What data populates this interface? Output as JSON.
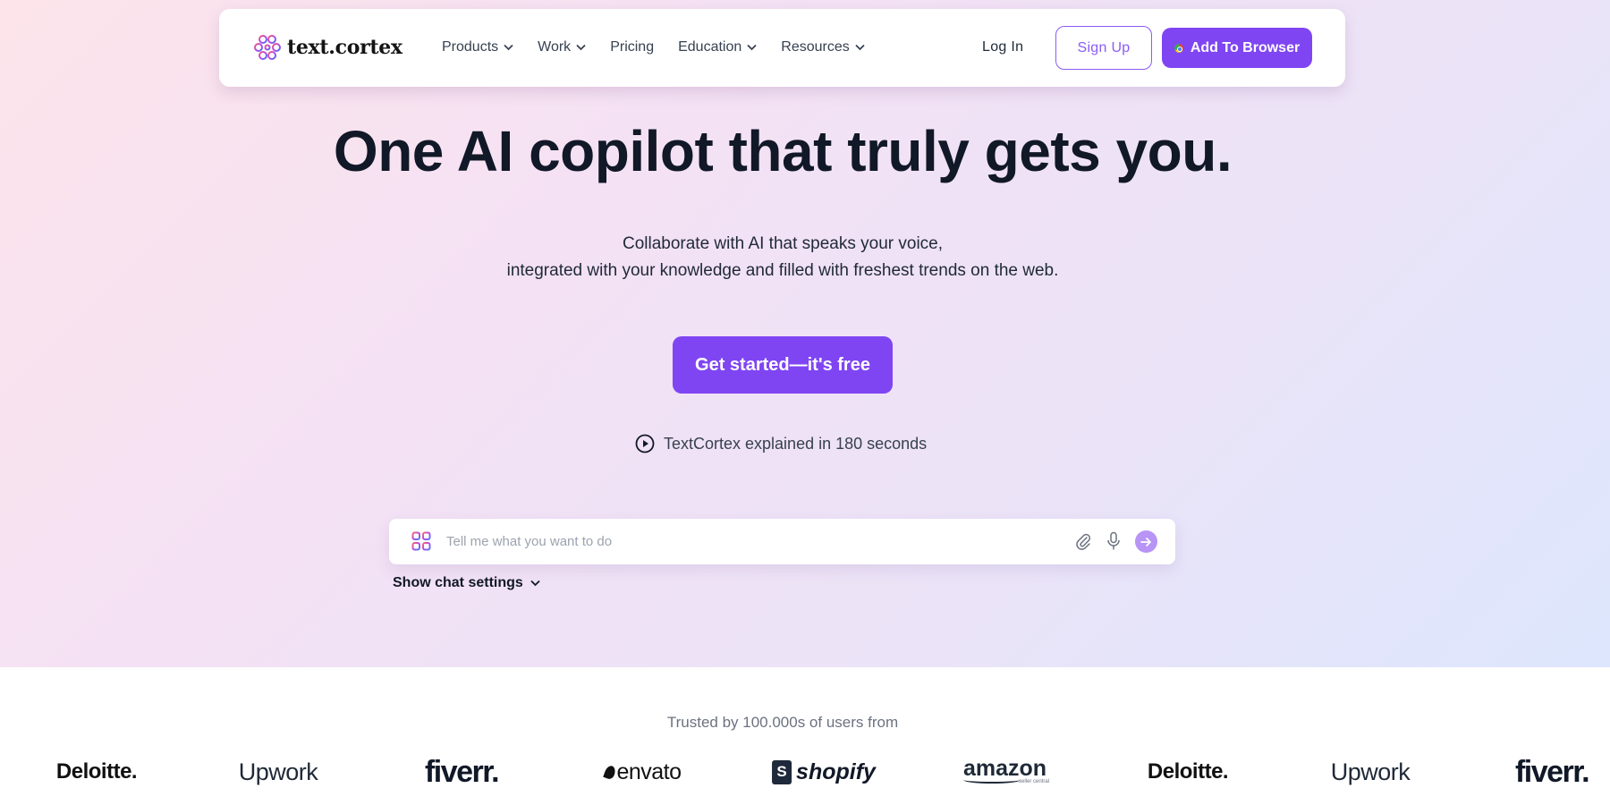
{
  "nav": {
    "brand": "text.cortex",
    "links": [
      {
        "label": "Products",
        "has_dropdown": true
      },
      {
        "label": "Work",
        "has_dropdown": true
      },
      {
        "label": "Pricing",
        "has_dropdown": false
      },
      {
        "label": "Education",
        "has_dropdown": true
      },
      {
        "label": "Resources",
        "has_dropdown": true
      }
    ],
    "login": "Log In",
    "signup": "Sign Up",
    "add_browser": "Add To Browser"
  },
  "hero": {
    "headline": "One AI copilot that truly gets you.",
    "subtitle_line1": "Collaborate with AI that speaks your voice,",
    "subtitle_line2": "integrated with your knowledge and filled with freshest trends on the web.",
    "cta": "Get started—it's free",
    "video_link": "TextCortex explained in 180 seconds"
  },
  "chat": {
    "placeholder": "Tell me what you want to do",
    "value": "",
    "settings_toggle": "Show chat settings"
  },
  "trusted": {
    "label": "Trusted by 100.000s of users from",
    "logos": [
      "Deloitte.",
      "Upwork",
      "fiverr.",
      "envato",
      "shopify",
      "amazon",
      "Deloitte.",
      "Upwork",
      "fiverr."
    ],
    "amazon_sub": "seller central"
  },
  "colors": {
    "accent": "#7f45f3",
    "accent_light": "#b794f6",
    "text_dark": "#111827"
  }
}
